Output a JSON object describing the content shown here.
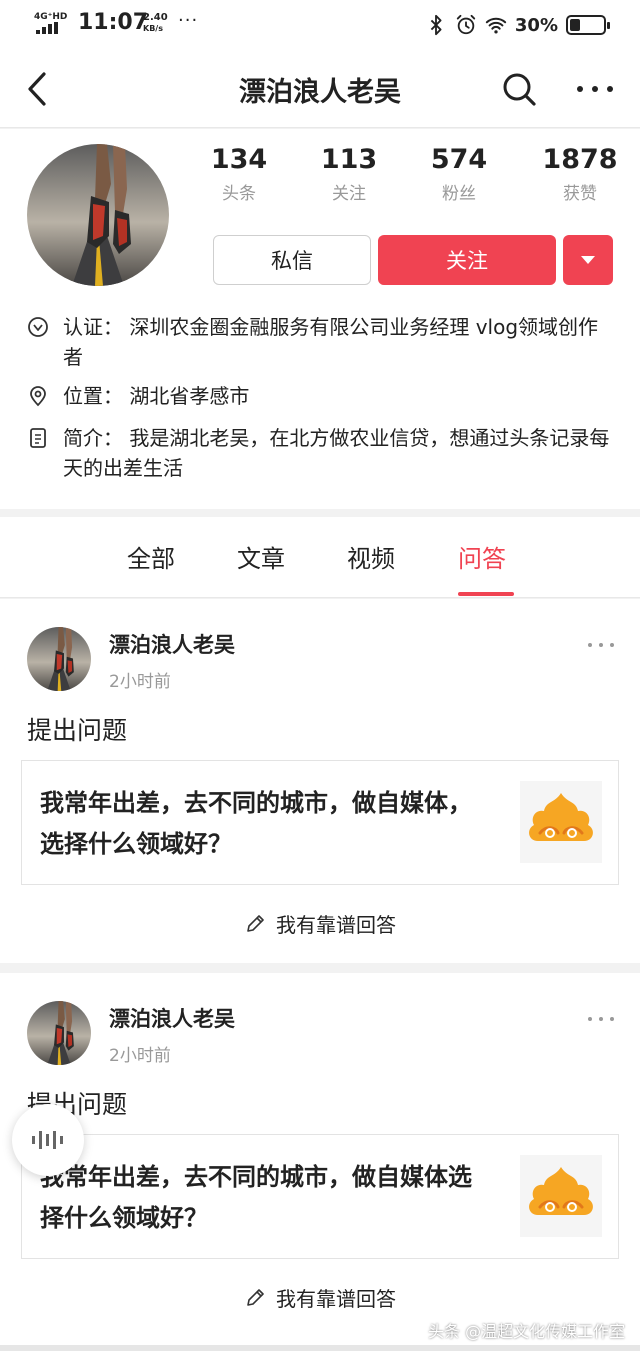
{
  "status_bar": {
    "network": "4G⁺HD",
    "time": "11:07",
    "speed_value": "2.40",
    "speed_unit": "KB/s",
    "overflow": "···",
    "battery_percent": "30%",
    "battery_level": 0.3
  },
  "header": {
    "title": "漂泊浪人老吴",
    "icons": [
      "back-icon",
      "search-icon",
      "more-icon"
    ]
  },
  "profile": {
    "stats": [
      {
        "value": "134",
        "label": "头条"
      },
      {
        "value": "113",
        "label": "关注"
      },
      {
        "value": "574",
        "label": "粉丝"
      },
      {
        "value": "1878",
        "label": "获赞"
      }
    ],
    "message_label": "私信",
    "follow_label": "关注",
    "verify_text": "认证： 深圳农金圈金融服务有限公司业务经理 vlog领域创作者",
    "location_text": "位置： 湖北省孝感市",
    "intro_text": "简介： 我是湖北老吴，在北方做农业信贷，想通过头条记录每天的出差生活"
  },
  "tabs": {
    "items": [
      "全部",
      "文章",
      "视频",
      "问答"
    ],
    "active": "问答"
  },
  "cards": [
    {
      "author": "漂泊浪人老吴",
      "time": "2小时前",
      "kind": "提出问题",
      "question": "我常年出差，去不同的城市，做自媒体，选择什么领域好？",
      "answer_label": "我有靠谱回答"
    },
    {
      "author": "漂泊浪人老吴",
      "time": "2小时前",
      "kind": "提出问题",
      "question": "我常年出差，去不同的城市，做自媒体选择什么领域好？",
      "answer_label": "我有靠谱回答"
    }
  ],
  "watermark": "头条 @温超文化传媒工作室",
  "colors": {
    "accent": "#f04352",
    "muted": "#999999",
    "divider": "#f2f2f2"
  }
}
